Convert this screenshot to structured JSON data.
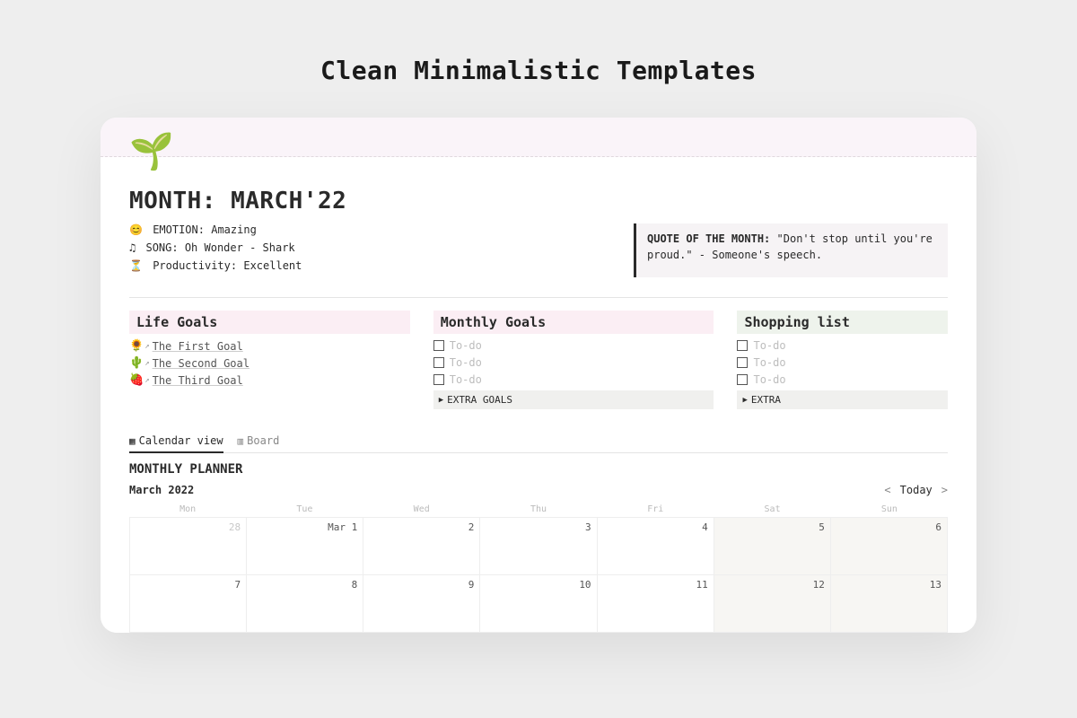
{
  "heading": "Clean Minimalistic Templates",
  "page": {
    "icon": "🌱",
    "title": "MONTH: MARCH'22"
  },
  "meta": {
    "emotion": {
      "icon": "😊",
      "label": "EMOTION:",
      "value": "Amazing"
    },
    "song": {
      "icon": "♫",
      "label": "SONG:",
      "value": "Oh Wonder - Shark"
    },
    "prod": {
      "icon": "⏳",
      "label": "Productivity:",
      "value": "Excellent"
    }
  },
  "quote": {
    "label": "QUOTE OF THE MONTH:",
    "text": "\"Don't stop until you're proud.\" - Someone's speech."
  },
  "life": {
    "header": "Life Goals",
    "items": [
      {
        "icon": "🌻",
        "label": "The First Goal"
      },
      {
        "icon": "🌵",
        "label": "The Second Goal"
      },
      {
        "icon": "🍓",
        "label": "The Third Goal"
      }
    ]
  },
  "monthly": {
    "header": "Monthly Goals",
    "todos": [
      "To-do",
      "To-do",
      "To-do"
    ],
    "extra": "EXTRA GOALS"
  },
  "shopping": {
    "header": "Shopping list",
    "todos": [
      "To-do",
      "To-do",
      "To-do"
    ],
    "extra": "EXTRA"
  },
  "views": {
    "calendar": "Calendar view",
    "board": "Board"
  },
  "planner": {
    "title": "MONTHLY PLANNER",
    "month_label": "March 2022",
    "today_label": "Today",
    "dow": [
      "Mon",
      "Tue",
      "Wed",
      "Thu",
      "Fri",
      "Sat",
      "Sun"
    ],
    "cells": [
      {
        "n": "28",
        "out": true
      },
      {
        "n": "Mar 1"
      },
      {
        "n": "2"
      },
      {
        "n": "3"
      },
      {
        "n": "4"
      },
      {
        "n": "5",
        "weekend": true
      },
      {
        "n": "6",
        "weekend": true
      },
      {
        "n": "7"
      },
      {
        "n": "8"
      },
      {
        "n": "9"
      },
      {
        "n": "10"
      },
      {
        "n": "11"
      },
      {
        "n": "12",
        "weekend": true
      },
      {
        "n": "13",
        "weekend": true
      }
    ]
  }
}
